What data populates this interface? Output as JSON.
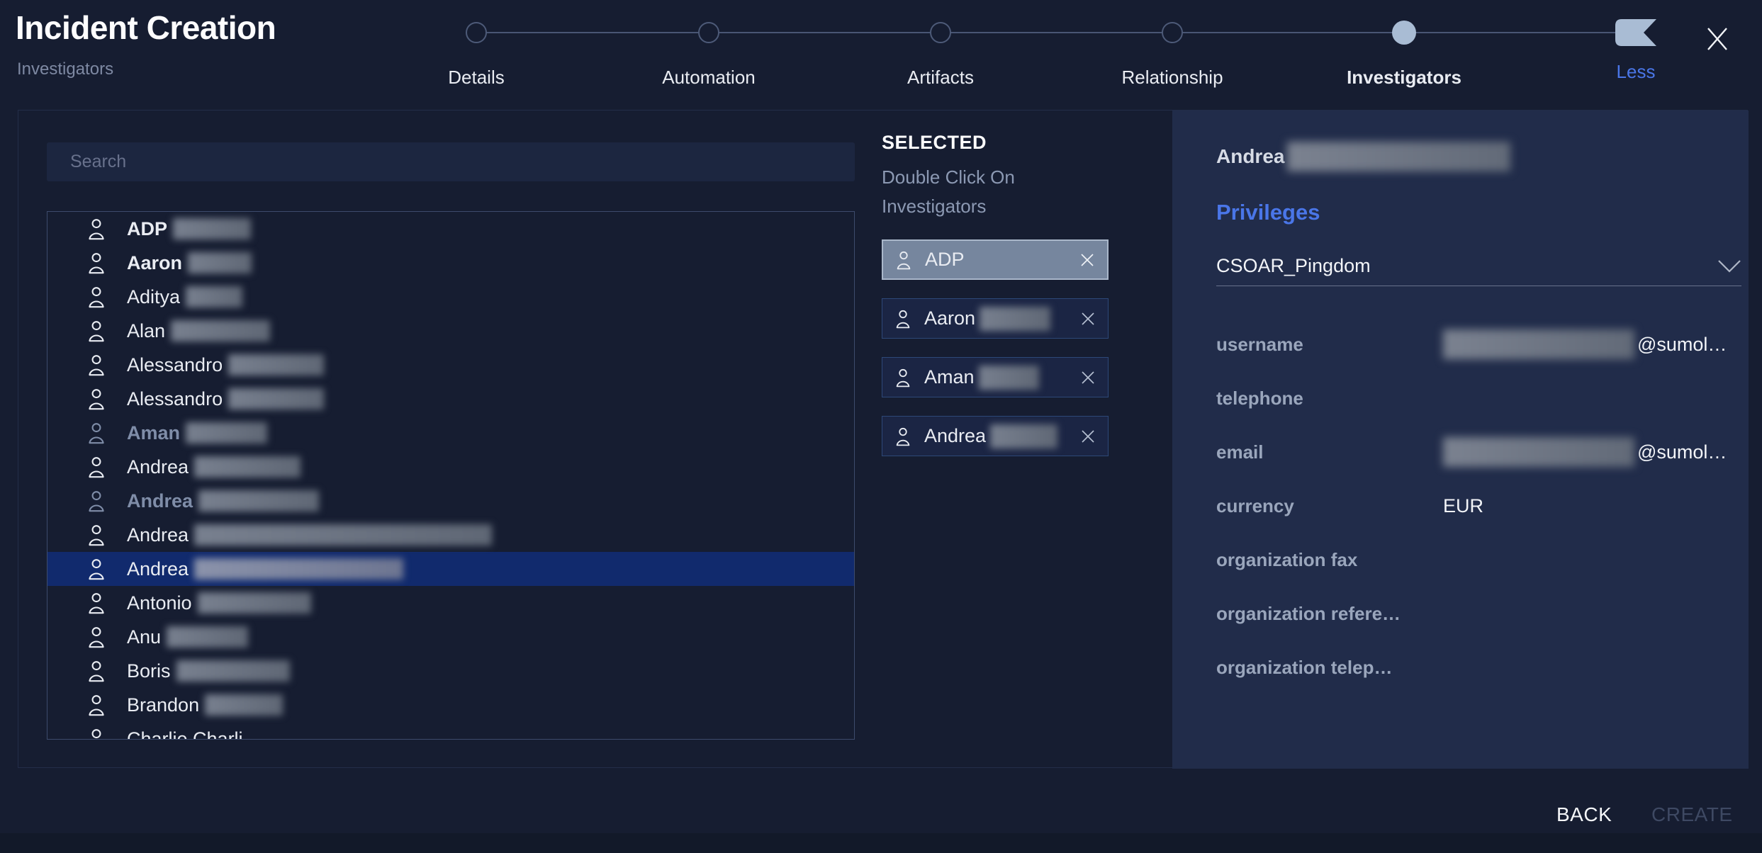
{
  "header": {
    "title": "Incident Creation",
    "subtitle": "Investigators",
    "steps": [
      {
        "label": "Details",
        "active": false
      },
      {
        "label": "Automation",
        "active": false
      },
      {
        "label": "Artifacts",
        "active": false
      },
      {
        "label": "Relationship",
        "active": false
      },
      {
        "label": "Investigators",
        "active": true
      }
    ],
    "collapse_label": "Less"
  },
  "search": {
    "placeholder": "Search"
  },
  "investigators": [
    {
      "name": "ADP",
      "bold": true,
      "muted": false,
      "selected": false,
      "blur_width": 110
    },
    {
      "name": "Aaron",
      "bold": true,
      "muted": false,
      "selected": false,
      "blur_width": 90
    },
    {
      "name": "Aditya",
      "bold": false,
      "muted": false,
      "selected": false,
      "blur_width": 80
    },
    {
      "name": "Alan",
      "bold": false,
      "muted": false,
      "selected": false,
      "blur_width": 140
    },
    {
      "name": "Alessandro",
      "bold": false,
      "muted": false,
      "selected": false,
      "blur_width": 135
    },
    {
      "name": "Alessandro",
      "bold": false,
      "muted": false,
      "selected": false,
      "blur_width": 135
    },
    {
      "name": "Aman",
      "bold": false,
      "muted": true,
      "selected": false,
      "blur_width": 115
    },
    {
      "name": "Andrea",
      "bold": false,
      "muted": false,
      "selected": false,
      "blur_width": 150
    },
    {
      "name": "Andrea",
      "bold": false,
      "muted": true,
      "selected": false,
      "blur_width": 170
    },
    {
      "name": "Andrea",
      "bold": false,
      "muted": false,
      "selected": false,
      "blur_width": 420
    },
    {
      "name": "Andrea",
      "bold": false,
      "muted": false,
      "selected": true,
      "blur_width": 295
    },
    {
      "name": "Antonio",
      "bold": false,
      "muted": false,
      "selected": false,
      "blur_width": 160
    },
    {
      "name": "Anu",
      "bold": false,
      "muted": false,
      "selected": false,
      "blur_width": 115
    },
    {
      "name": "Boris",
      "bold": false,
      "muted": false,
      "selected": false,
      "blur_width": 160
    },
    {
      "name": "Brandon",
      "bold": false,
      "muted": false,
      "selected": false,
      "blur_width": 110
    },
    {
      "name": "Charlie Charli",
      "bold": false,
      "muted": false,
      "selected": false,
      "blur_width": 0
    }
  ],
  "selected_panel": {
    "title": "SELECTED",
    "hint": "Double Click On Investigators",
    "chips": [
      {
        "name": "ADP",
        "highlighted": true,
        "blur_width": 0
      },
      {
        "name": "Aaron",
        "highlighted": false,
        "blur_width": 100
      },
      {
        "name": "Aman",
        "highlighted": false,
        "blur_width": 85
      },
      {
        "name": "Andrea",
        "highlighted": false,
        "blur_width": 95
      }
    ]
  },
  "details_panel": {
    "person_first_name": "Andrea",
    "section_title": "Privileges",
    "privilege_value": "CSOAR_Pingdom",
    "fields": [
      {
        "label": "username",
        "value": "@sumol…",
        "blurred": true
      },
      {
        "label": "telephone",
        "value": "",
        "blurred": false
      },
      {
        "label": "email",
        "value": "@sumol…",
        "blurred": true
      },
      {
        "label": "currency",
        "value": "EUR",
        "blurred": false
      },
      {
        "label": "organization fax",
        "value": "",
        "blurred": false
      },
      {
        "label": "organization refere…",
        "value": "",
        "blurred": false
      },
      {
        "label": "organization telep…",
        "value": "",
        "blurred": false
      }
    ]
  },
  "footer": {
    "back_label": "BACK",
    "create_label": "CREATE"
  },
  "colors": {
    "page_bg": "#161d31",
    "accent_blue": "#4a76e8",
    "step_active_fill": "#a9bcd4",
    "selected_row_bg": "#112a6d",
    "chip_highlight_bg": "#76869e",
    "chip_highlight_border": "#aab7ca",
    "detail_panel_bg": "#212c4a"
  }
}
